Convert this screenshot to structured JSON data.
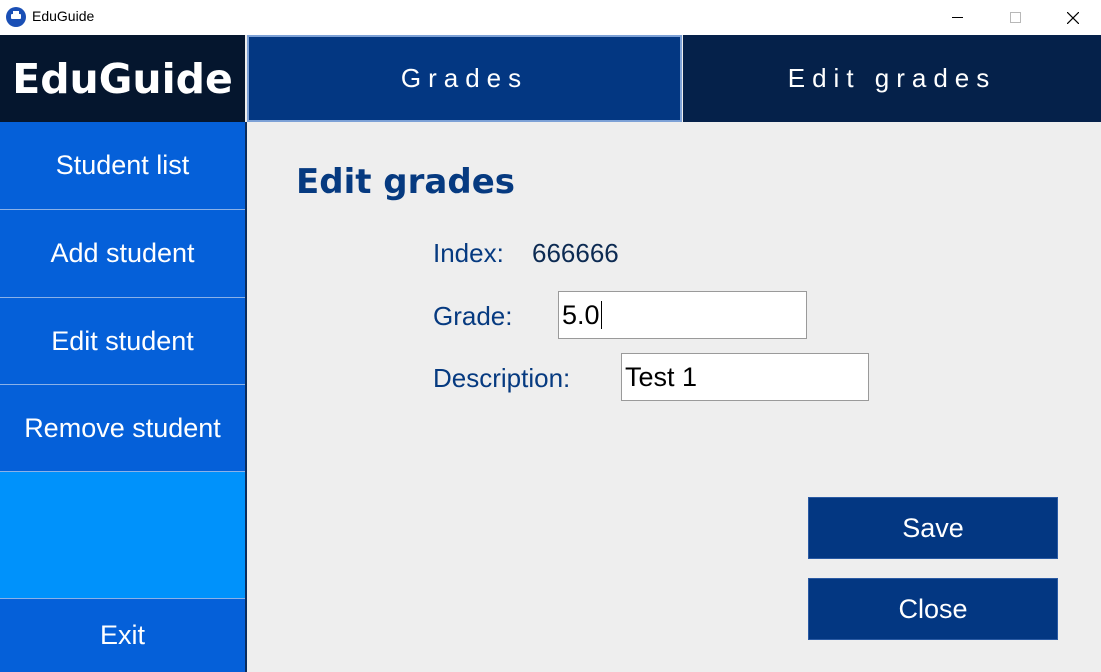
{
  "window": {
    "title": "EduGuide"
  },
  "logo": {
    "text": "EduGuide"
  },
  "tabs": [
    {
      "label": "Grades"
    },
    {
      "label": "Edit grades"
    }
  ],
  "sidebar": {
    "items": [
      {
        "label": "Student list"
      },
      {
        "label": "Add student"
      },
      {
        "label": "Edit student"
      },
      {
        "label": "Remove student"
      },
      {
        "label": "Exit"
      }
    ]
  },
  "form": {
    "heading": "Edit grades",
    "index_label": "Index:",
    "index_value": "666666",
    "grade_label": "Grade:",
    "grade_value": "5.0",
    "description_label": "Description:",
    "description_value": "Test 1"
  },
  "buttons": {
    "save": "Save",
    "close": "Close"
  },
  "colors": {
    "logo_bg": "#05162e",
    "tab_active": "#033782",
    "tab_inactive": "#05214a",
    "sidebar_item": "#0560d9",
    "sidebar_filler": "#0092fb",
    "heading_text": "#063a80",
    "button_bg": "#033782"
  },
  "icons": {
    "app": "graduation-cap-icon",
    "minimize": "minimize-icon",
    "maximize": "maximize-icon",
    "close": "close-icon"
  }
}
